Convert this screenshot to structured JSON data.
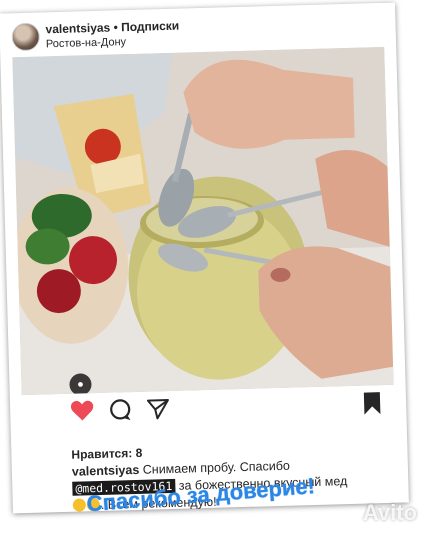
{
  "post": {
    "username": "valentsiyas",
    "separator": " • ",
    "follow_label": "Подписки",
    "location": "Ростов-на-Дону"
  },
  "actions": {
    "like_icon": "heart-icon",
    "comment_icon": "comment-icon",
    "share_icon": "send-icon",
    "save_icon": "bookmark-icon",
    "like_color": "#ed4956"
  },
  "likes": {
    "label": "Нравится:",
    "count": "8"
  },
  "caption": {
    "username": "valentsiyas",
    "text_part1": "Снимаем пробу. Спасибо",
    "mention": "@med.rostov161",
    "text_part2": "за божественно вкусный мед",
    "text_part3": ". Всем рекомендую!"
  },
  "overlay": {
    "thanks_text": "Спасибо за доверие!",
    "thanks_color": "#2b86e6",
    "watermark": "Avito"
  }
}
